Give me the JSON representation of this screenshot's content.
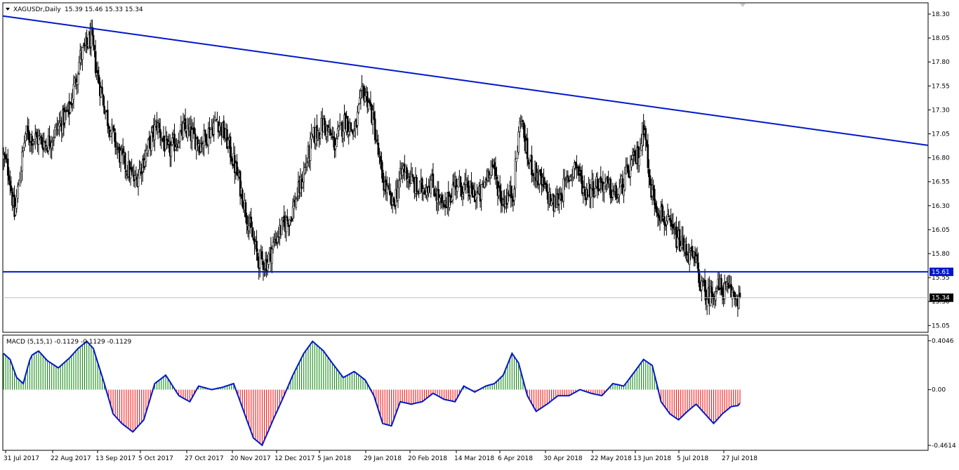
{
  "header": {
    "symbol_label": "XAGUSDr,Daily",
    "ohlc_label": "15.39 15.46 15.33 15.34"
  },
  "macd": {
    "label": "MACD (5,15,1) -0.1129 -0.1129 -0.1129"
  },
  "chart_data": [
    {
      "type": "candlestick",
      "symbol": "XAGUSDr",
      "timeframe": "Daily",
      "last_ohlc": {
        "open": 15.39,
        "high": 15.46,
        "low": 15.33,
        "close": 15.34
      },
      "ylim": [
        14.95,
        18.38
      ],
      "y_ticks": [
        "18.30",
        "18.05",
        "17.80",
        "17.55",
        "17.30",
        "17.05",
        "16.80",
        "16.55",
        "16.30",
        "16.05",
        "15.80",
        "15.55",
        "15.30",
        "15.05"
      ],
      "x_ticks": [
        "31 Jul 2017",
        "22 Aug 2017",
        "13 Sep 2017",
        "5 Oct 2017",
        "27 Oct 2017",
        "20 Nov 2017",
        "12 Dec 2017",
        "5 Jan 2018",
        "29 Jan 2018",
        "20 Feb 2018",
        "14 Mar 2018",
        "6 Apr 2018",
        "30 Apr 2018",
        "22 May 2018",
        "13 Jun 2018",
        "5 Jul 2018",
        "27 Jul 2018"
      ],
      "bar_count": 263,
      "close_path_anchors": [
        [
          0,
          16.8
        ],
        [
          5,
          16.65
        ],
        [
          10,
          16.2
        ],
        [
          20,
          17.05
        ],
        [
          40,
          16.95
        ],
        [
          60,
          17.3
        ],
        [
          70,
          17.85
        ],
        [
          80,
          18.05
        ],
        [
          85,
          17.7
        ],
        [
          95,
          17.2
        ],
        [
          105,
          16.85
        ],
        [
          120,
          16.55
        ],
        [
          130,
          16.85
        ],
        [
          140,
          17.15
        ],
        [
          150,
          16.85
        ],
        [
          165,
          17.1
        ],
        [
          180,
          16.95
        ],
        [
          195,
          17.2
        ],
        [
          205,
          16.95
        ],
        [
          215,
          16.55
        ],
        [
          222,
          16.2
        ],
        [
          232,
          15.75
        ],
        [
          240,
          15.7
        ],
        [
          250,
          16.0
        ],
        [
          262,
          16.2
        ],
        [
          272,
          16.55
        ],
        [
          282,
          17.0
        ],
        [
          292,
          17.15
        ],
        [
          302,
          16.95
        ],
        [
          312,
          17.2
        ],
        [
          320,
          17.05
        ],
        [
          328,
          17.5
        ],
        [
          333,
          17.4
        ],
        [
          338,
          17.15
        ],
        [
          345,
          16.6
        ],
        [
          355,
          16.3
        ],
        [
          365,
          16.7
        ],
        [
          378,
          16.45
        ],
        [
          390,
          16.55
        ],
        [
          402,
          16.25
        ],
        [
          412,
          16.55
        ],
        [
          425,
          16.45
        ],
        [
          435,
          16.4
        ],
        [
          445,
          16.75
        ],
        [
          455,
          16.35
        ],
        [
          465,
          16.45
        ],
        [
          472,
          17.25
        ],
        [
          478,
          16.8
        ],
        [
          490,
          16.55
        ],
        [
          502,
          16.3
        ],
        [
          512,
          16.5
        ],
        [
          522,
          16.75
        ],
        [
          530,
          16.45
        ],
        [
          545,
          16.55
        ],
        [
          560,
          16.4
        ],
        [
          572,
          16.7
        ],
        [
          580,
          16.85
        ],
        [
          585,
          17.2
        ],
        [
          589,
          16.55
        ],
        [
          596,
          16.3
        ],
        [
          606,
          16.1
        ],
        [
          615,
          15.95
        ],
        [
          625,
          15.8
        ],
        [
          632,
          15.7
        ],
        [
          637,
          15.45
        ],
        [
          642,
          15.35
        ],
        [
          652,
          15.45
        ],
        [
          662,
          15.4
        ],
        [
          672,
          15.34
        ]
      ],
      "last_price": 15.34
    },
    {
      "type": "line",
      "name": "",
      "x": [
        "14 Jul 2017",
        "31 Jul 2018"
      ],
      "values": [
        18.28,
        16.93
      ]
    },
    {
      "type": "line",
      "name": "",
      "x": [
        "14 Jul 2017",
        "31 Jul 2018"
      ],
      "values": [
        15.61,
        15.61
      ],
      "price_label": "15.61"
    },
    {
      "type": "bar",
      "indicator": "MACD",
      "params": "5,15,1",
      "ylim": [
        -0.4614,
        0.4046
      ],
      "y_ticks": [
        "0.4046",
        "0.00",
        "-0.4614"
      ],
      "signal_path_anchors": [
        [
          0,
          0.3
        ],
        [
          6,
          0.25
        ],
        [
          12,
          0.1
        ],
        [
          18,
          0.05
        ],
        [
          25,
          0.28
        ],
        [
          32,
          0.32
        ],
        [
          40,
          0.24
        ],
        [
          50,
          0.18
        ],
        [
          60,
          0.26
        ],
        [
          68,
          0.34
        ],
        [
          76,
          0.4
        ],
        [
          82,
          0.34
        ],
        [
          92,
          0.05
        ],
        [
          100,
          -0.2
        ],
        [
          108,
          -0.28
        ],
        [
          118,
          -0.35
        ],
        [
          128,
          -0.25
        ],
        [
          138,
          0.05
        ],
        [
          148,
          0.12
        ],
        [
          160,
          -0.05
        ],
        [
          170,
          -0.1
        ],
        [
          178,
          0.03
        ],
        [
          190,
          0.0
        ],
        [
          200,
          0.02
        ],
        [
          210,
          0.05
        ],
        [
          218,
          -0.15
        ],
        [
          228,
          -0.4
        ],
        [
          236,
          -0.46
        ],
        [
          246,
          -0.25
        ],
        [
          256,
          -0.05
        ],
        [
          264,
          0.12
        ],
        [
          274,
          0.3
        ],
        [
          282,
          0.4
        ],
        [
          292,
          0.32
        ],
        [
          300,
          0.22
        ],
        [
          310,
          0.1
        ],
        [
          320,
          0.15
        ],
        [
          330,
          0.08
        ],
        [
          338,
          -0.05
        ],
        [
          346,
          -0.28
        ],
        [
          354,
          -0.3
        ],
        [
          362,
          -0.1
        ],
        [
          372,
          -0.12
        ],
        [
          382,
          -0.1
        ],
        [
          392,
          -0.03
        ],
        [
          402,
          -0.08
        ],
        [
          412,
          -0.1
        ],
        [
          420,
          0.03
        ],
        [
          430,
          -0.02
        ],
        [
          440,
          0.03
        ],
        [
          448,
          0.05
        ],
        [
          456,
          0.12
        ],
        [
          464,
          0.3
        ],
        [
          470,
          0.22
        ],
        [
          478,
          -0.05
        ],
        [
          486,
          -0.18
        ],
        [
          496,
          -0.12
        ],
        [
          506,
          -0.05
        ],
        [
          516,
          -0.05
        ],
        [
          526,
          0.0
        ],
        [
          536,
          -0.03
        ],
        [
          546,
          -0.05
        ],
        [
          556,
          0.05
        ],
        [
          566,
          0.03
        ],
        [
          576,
          0.15
        ],
        [
          584,
          0.25
        ],
        [
          592,
          0.2
        ],
        [
          600,
          -0.1
        ],
        [
          608,
          -0.2
        ],
        [
          616,
          -0.25
        ],
        [
          624,
          -0.18
        ],
        [
          632,
          -0.12
        ],
        [
          640,
          -0.2
        ],
        [
          648,
          -0.28
        ],
        [
          656,
          -0.2
        ],
        [
          664,
          -0.14
        ],
        [
          672,
          -0.13
        ]
      ],
      "last_value": -0.1129
    }
  ],
  "colors": {
    "background": "#ffffff",
    "candle": "#000000",
    "trendline": "#0018c8",
    "support": "#0018c8",
    "price_line": "#c0c0c0",
    "macd_up": "#008000",
    "macd_down": "#ff0000",
    "signal_line": "#0018c8"
  }
}
